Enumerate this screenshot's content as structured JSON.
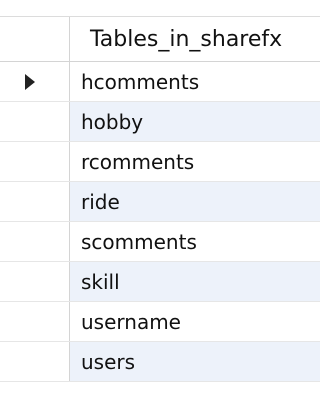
{
  "table": {
    "column_header": "Tables_in_sharefx",
    "current_row_indicator": "arrow-right-icon",
    "rows": [
      {
        "value": "hcomments",
        "current": true
      },
      {
        "value": "hobby",
        "current": false
      },
      {
        "value": "rcomments",
        "current": false
      },
      {
        "value": "ride",
        "current": false
      },
      {
        "value": "scomments",
        "current": false
      },
      {
        "value": "skill",
        "current": false
      },
      {
        "value": "username",
        "current": false
      },
      {
        "value": "users",
        "current": false
      }
    ]
  },
  "colors": {
    "header_text": "#111111",
    "alt_row_background": "#edf2fa",
    "grid_line": "#d4d4d4"
  }
}
